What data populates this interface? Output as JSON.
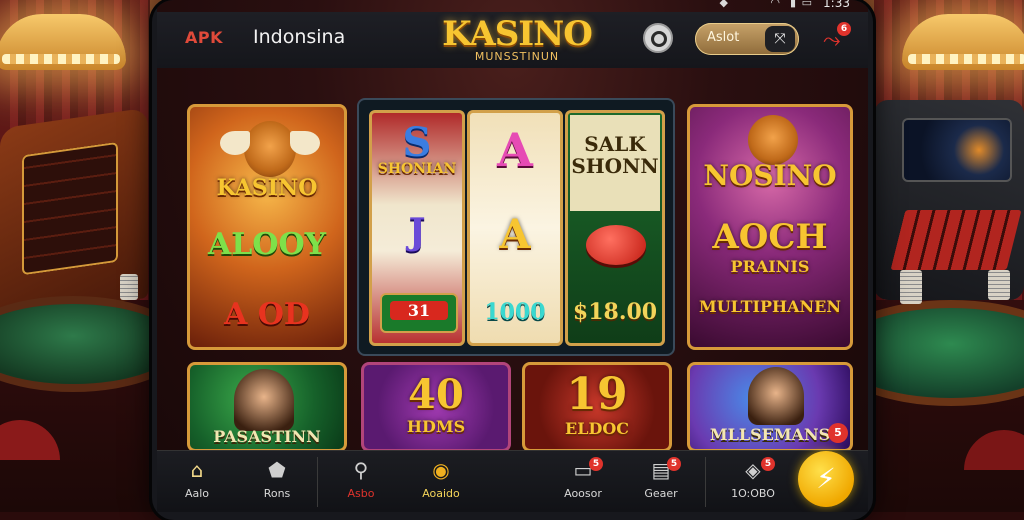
{
  "status_bar": {
    "time": "1:33",
    "wifi_icon": "wifi-icon",
    "signal_icon": "signal-icon"
  },
  "header": {
    "apk_logo": "APK",
    "region": "Indonsina",
    "brand_title": "KASINO",
    "brand_subtitle": "MUNSSTINUN",
    "account_label": "Aslot",
    "share_badge": "6"
  },
  "games": {
    "left_card": {
      "title": "KASINO",
      "line1": "ALOOY",
      "line2": "A OD"
    },
    "slot": {
      "reel1_top": "S",
      "reel1_top_label": "SHONIAN",
      "reel1_mid": "J",
      "reel1_bottom": "31",
      "reel2_top": "A",
      "reel2_mid": "A",
      "reel2_bottom": "1000",
      "reel3_top": "SALK SHONN",
      "reel3_bottom": "$18.00"
    },
    "right_card": {
      "title": "NOSINO",
      "line1": "AOCH",
      "line2": "PRAINIS",
      "line3": "MULTIPHANEN"
    },
    "row2": [
      {
        "label": "PASASTINN"
      },
      {
        "big": "40",
        "small": "HDMS"
      },
      {
        "big": "19",
        "small": "ELDOC"
      },
      {
        "label": "MLLSEMANS",
        "badge": "5"
      }
    ]
  },
  "bottom_nav": {
    "items": [
      {
        "label": "Aalo",
        "icon": "home-icon",
        "active": true
      },
      {
        "label": "Rons",
        "icon": "shield-icon"
      },
      {
        "label": "Asbo",
        "icon": "search-icon"
      },
      {
        "label": "Aoaido",
        "icon": "chip-icon"
      },
      {
        "label": "Aoosor",
        "icon": "chat-icon",
        "badge": "5"
      },
      {
        "label": "Geaer",
        "icon": "message-icon",
        "badge": "5"
      },
      {
        "label": "1O:OBO",
        "icon": "gift-icon",
        "badge": "5"
      }
    ],
    "fab_icon": "lightning-icon"
  },
  "colors": {
    "accent": "#f7c531",
    "alert": "#e0332c",
    "frame": "#d79a3a"
  }
}
